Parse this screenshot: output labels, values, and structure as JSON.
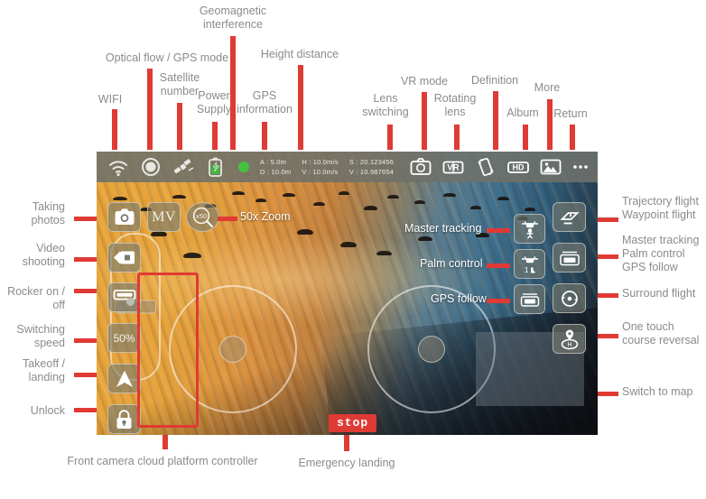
{
  "meta": {
    "title": "Drone app flight interface annotated diagram"
  },
  "colors": {
    "accent": "#e03a34",
    "label": "#8b8b8b",
    "glass": "rgba(120,122,112,0.62)"
  },
  "status_bar": {
    "icons": [
      {
        "name": "wifi-icon",
        "label": "WIFI"
      },
      {
        "name": "optical-flow-gps-mode-icon",
        "label": "Optical flow / GPS mode"
      },
      {
        "name": "satellite-icon",
        "label": "Satellite number"
      },
      {
        "name": "battery-icon",
        "label": "Power Supply"
      },
      {
        "name": "geomagnetic-interference-icon",
        "label": "Geomagnetic interference"
      }
    ],
    "telemetry": {
      "altitude": "A : 5.0m",
      "distance": "D : 10.0m",
      "horizontal_speed": "H : 10.0m/s",
      "vertical_speed": "V : 10.0m/s",
      "longitude": "S : 20.123456",
      "latitude": "V : 10.987654"
    },
    "right_icons": [
      {
        "name": "lens-switching-icon",
        "label": "Lens switching"
      },
      {
        "name": "vr-mode-icon",
        "label": "VR mode",
        "text": "VR"
      },
      {
        "name": "rotating-lens-icon",
        "label": "Rotating lens"
      },
      {
        "name": "definition-icon",
        "label": "Definition",
        "text": "HD"
      },
      {
        "name": "album-icon",
        "label": "Album"
      },
      {
        "name": "more-icon",
        "label": "More"
      },
      {
        "name": "return-icon",
        "label": "Return"
      }
    ]
  },
  "left_controls": [
    {
      "name": "take-photo-button",
      "label": "Taking photos"
    },
    {
      "name": "video-record-button",
      "label": "Video shooting"
    },
    {
      "name": "rocker-toggle-button",
      "label": "Rocker on / off"
    },
    {
      "name": "speed-switch-button",
      "label": "Switching speed",
      "text": "50%"
    },
    {
      "name": "takeoff-landing-button",
      "label": "Takeoff / landing"
    },
    {
      "name": "unlock-button",
      "label": "Unlock"
    }
  ],
  "left_extra": [
    {
      "name": "mv-button",
      "text": "MV"
    },
    {
      "name": "zoom-button",
      "text": "x50",
      "label": "50x Zoom"
    }
  ],
  "right_controls": [
    {
      "name": "trajectory-waypoint-flight-button",
      "label": "Trajectory flight\nWaypoint flight"
    },
    {
      "name": "master-tracking-palm-gps-button",
      "label": "Master tracking\nPalm control\nGPS follow"
    },
    {
      "name": "surround-flight-button",
      "label": "Surround flight"
    },
    {
      "name": "one-touch-course-reversal-button",
      "label": "One touch\ncourse reversal"
    },
    {
      "name": "switch-to-map-button",
      "label": "Switch to map"
    }
  ],
  "overlay_labels": {
    "zoom": "50x Zoom",
    "master_tracking": "Master tracking",
    "palm_control": "Palm control",
    "gps_follow": "GPS follow"
  },
  "bottom_labels": {
    "gimbal": "Front camera cloud platform controller",
    "emergency": "Emergency landing",
    "stop_text": "stop"
  },
  "top_labels": {
    "wifi": "WIFI",
    "optical_flow": "Optical flow / GPS mode",
    "satellite": "Satellite\nnumber",
    "power": "Power\nSupply",
    "geomagnetic": "Geomagnetic\ninterference",
    "gps_info": "GPS\ninformation",
    "height_distance": "Height distance",
    "lens_switching": "Lens\nswitching",
    "vr_mode": "VR mode",
    "rotating_lens": "Rotating\nlens",
    "definition": "Definition",
    "album": "Album",
    "more": "More",
    "return": "Return"
  }
}
